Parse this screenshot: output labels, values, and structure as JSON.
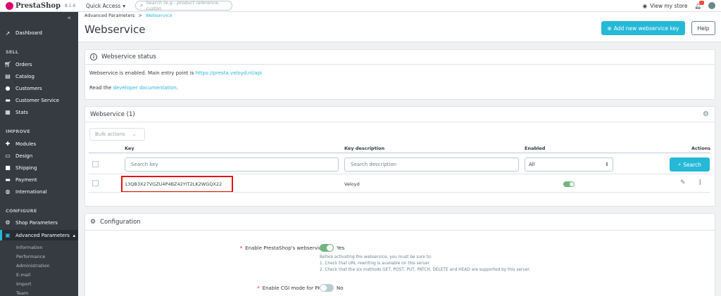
{
  "topbar": {
    "brand": "PrestaShop",
    "version": "8.1.6",
    "quick_access": "Quick Access",
    "search_placeholder": "Search (e.g.: product reference, custon",
    "view_store": "View my store"
  },
  "sidebar": {
    "collapse_glyph": "«",
    "dashboard": "Dashboard",
    "sell_section": "SELL",
    "sell_items": [
      "Orders",
      "Catalog",
      "Customers",
      "Customer Service",
      "Stats"
    ],
    "improve_section": "IMPROVE",
    "improve_items": [
      "Modules",
      "Design",
      "Shipping",
      "Payment",
      "International"
    ],
    "configure_section": "CONFIGURE",
    "configure_items": [
      "Shop Parameters",
      "Advanced Parameters"
    ],
    "sub_items": [
      "Information",
      "Performance",
      "Administration",
      "E-mail",
      "Import",
      "Team"
    ]
  },
  "header": {
    "breadcrumb_parent": "Advanced Parameters",
    "breadcrumb_sep": ">",
    "breadcrumb_current": "Webservice",
    "title": "Webservice",
    "add_button": "Add new webservice key",
    "help_button": "Help"
  },
  "status_panel": {
    "title": "Webservice status",
    "line1_prefix": "Webservice is enabled. Main entry point is",
    "line1_link": "https://presta.veloyd.nl/api",
    "line2_prefix": "Read the",
    "line2_link": "developer documentation",
    "line2_suffix": "."
  },
  "list_panel": {
    "title": "Webservice (1)",
    "bulk_actions": "Bulk actions",
    "columns": [
      "Key",
      "Key description",
      "Enabled",
      "Actions"
    ],
    "filter_key_placeholder": "Search key",
    "filter_desc_placeholder": "Search description",
    "filter_enabled_value": "All",
    "search_button": "Search",
    "rows": [
      {
        "key": "13QB3X27VGZU4P4BZ42YIT2LK2WGQX22",
        "description": "Veloyd",
        "enabled": true
      }
    ]
  },
  "config_panel": {
    "title": "Configuration",
    "enable_label": "Enable PrestaShop's webservice",
    "enable_value": "Yes",
    "help_line1": "Before activating the webservice, you must be sure to:",
    "help_line2": "1. Check that URL rewriting is available on this server.",
    "help_line3": "2. Check that the six methods GET, POST, PUT, PATCH, DELETE and HEAD are supported by this server.",
    "cgi_label": "Enable CGI mode for PHP",
    "cgi_value": "No"
  },
  "colors": {
    "accent": "#25b9d7",
    "sidebar_bg": "#363a41",
    "toggle_on": "#70b580",
    "highlight_box": "#e3120b"
  }
}
